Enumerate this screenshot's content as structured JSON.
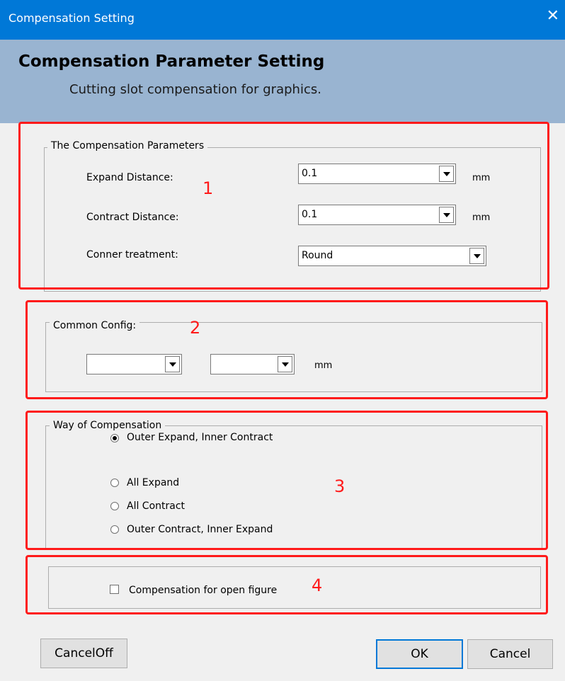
{
  "window": {
    "title": "Compensation Setting",
    "close_glyph": "✕"
  },
  "banner": {
    "heading": "Compensation Parameter Setting",
    "subheading": "Cutting slot compensation for graphics."
  },
  "params": {
    "legend": "The Compensation Parameters",
    "expand_label": "Expand Distance:",
    "expand_value": "0.1",
    "expand_unit": "mm",
    "contract_label": "Contract Distance:",
    "contract_value": "0.1",
    "contract_unit": "mm",
    "corner_label": "Conner treatment:",
    "corner_value": "Round"
  },
  "common": {
    "legend": "Common Config:",
    "combo1_value": "",
    "combo2_value": "",
    "unit": "mm"
  },
  "way": {
    "legend": "Way of Compensation",
    "options": [
      {
        "label": "Outer Expand, Inner Contract",
        "selected": true
      },
      {
        "label": "All Expand",
        "selected": false
      },
      {
        "label": "All Contract",
        "selected": false
      },
      {
        "label": "Outer Contract, Inner Expand",
        "selected": false
      }
    ]
  },
  "open_figure": {
    "label": "Compensation for open figure",
    "checked": false
  },
  "annotations": {
    "n1": "1",
    "n2": "2",
    "n3": "3",
    "n4": "4"
  },
  "buttons": {
    "cancel_off": "CancelOff",
    "ok": "OK",
    "cancel": "Cancel"
  },
  "colors": {
    "titlebar": "#0078d7",
    "banner": "#99b4d1",
    "annotation_red": "#ff1a1a"
  }
}
